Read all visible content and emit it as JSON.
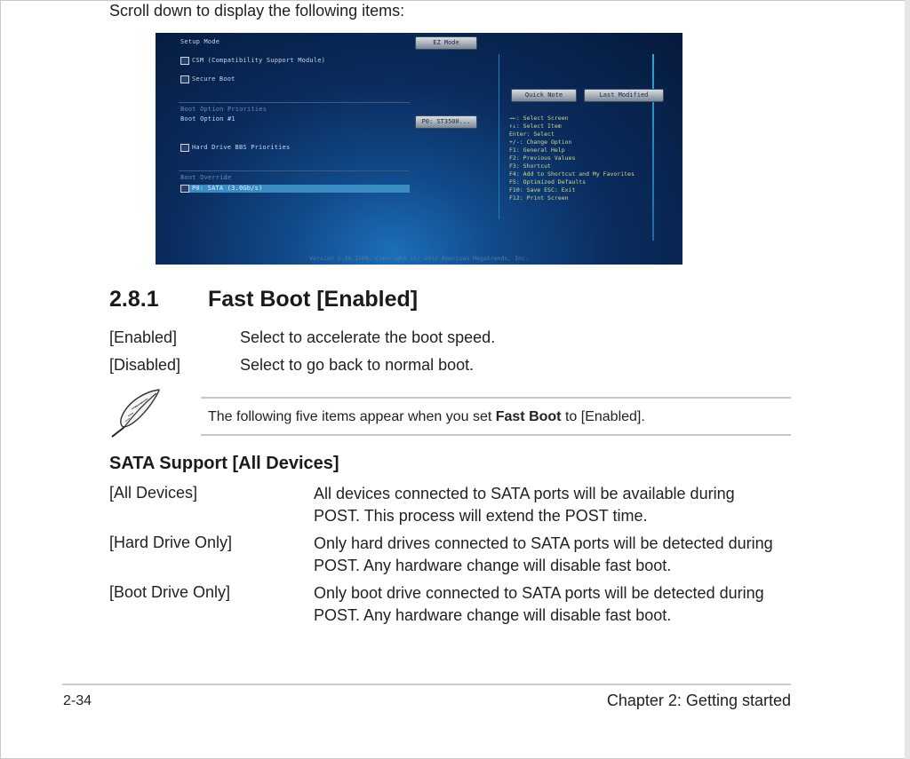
{
  "intro": "Scroll down to display the following items:",
  "bios": {
    "left_items": [
      "Setup Mode",
      "CSM (Compatibility Support Module)",
      "Secure Boot",
      "Boot Option Priorities",
      "Boot Option #1",
      "Hard Drive BBS Priorities",
      "Boot Override",
      "P0: SATA  (3.0Gb/s)"
    ],
    "setup_mode_value": "EZ Mode",
    "boot_option_value": "P0: ST3500...",
    "quick_note": "Quick Note",
    "last_modified": "Last Modified",
    "legend": [
      "→←: Select Screen",
      "↑↓: Select Item",
      "Enter: Select",
      "+/-: Change Option",
      "F1: General Help",
      "F2: Previous Values",
      "F3: Shortcut",
      "F4: Add to Shortcut and My Favorites",
      "F5: Optimized Defaults",
      "F10: Save  ESC: Exit",
      "F12: Print Screen"
    ],
    "version": "Version 2.10.1208. Copyright (C) 2012 American Megatrends, Inc."
  },
  "section": {
    "number": "2.8.1",
    "title": "Fast Boot [Enabled]",
    "options": [
      {
        "label": "[Enabled]",
        "desc": "Select to accelerate the boot speed."
      },
      {
        "label": "[Disabled]",
        "desc": "Select to go back to normal boot."
      }
    ]
  },
  "note": {
    "before": "The following five items appear when you set ",
    "bold": "Fast Boot",
    "after": " to [Enabled]."
  },
  "sata": {
    "title": "SATA Support [All Devices]",
    "items": [
      {
        "label": "[All Devices]",
        "line1": "All devices connected to SATA ports will be available during",
        "line2": "POST. This process will extend the POST time."
      },
      {
        "label": "[Hard Drive Only]",
        "line1": "Only hard drives connected to SATA ports will be detected during",
        "line2": "POST. Any hardware change will disable fast boot."
      },
      {
        "label": "[Boot Drive Only]",
        "line1": "Only boot drive connected to SATA ports will be detected during",
        "line2": "POST. Any hardware change will disable fast boot."
      }
    ]
  },
  "footer": {
    "page": "2-34",
    "chapter": "Chapter 2: Getting started"
  }
}
